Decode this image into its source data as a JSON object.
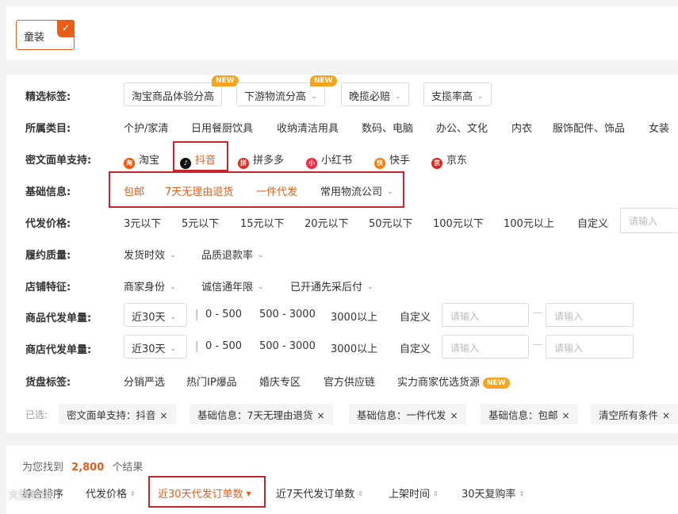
{
  "top": {
    "category_chip": "童装",
    "check": "✓"
  },
  "filters": {
    "featured_label": "精选标签:",
    "featured_items": [
      {
        "label": "淘宝商品体验分高",
        "new": true,
        "dropdown": false
      },
      {
        "label": "下游物流分高",
        "new": true,
        "dropdown": true
      },
      {
        "label": "晚揽必赔",
        "new": false,
        "dropdown": true
      },
      {
        "label": "支揽率高",
        "new": false,
        "dropdown": true
      }
    ],
    "new_badge": "NEW",
    "category_label": "所属类目:",
    "category_items": [
      "个护/家清",
      "日用餐厨饮具",
      "收纳清洁用具",
      "数码、电脑",
      "办公、文化",
      "内衣",
      "服饰配件、饰品",
      "女装"
    ],
    "waybill_label": "密文面单支持:",
    "waybill_items": [
      "淘宝",
      "抖音",
      "拼多多",
      "小红书",
      "快手",
      "京东"
    ],
    "basic_label": "基础信息:",
    "basic_items": [
      "包邮",
      "7天无理由退货",
      "一件代发",
      "常用物流公司"
    ],
    "price_label": "代发价格:",
    "price_items": [
      "3元以下",
      "5元以下",
      "15元以下",
      "20元以下",
      "50元以下",
      "100元以下",
      "100元以上",
      "自定义"
    ],
    "price_placeholder": "请输入",
    "fulfill_label": "履约质量:",
    "fulfill_items": [
      "发货时效",
      "品质退款率"
    ],
    "shop_label": "店铺特征:",
    "shop_items": [
      "商家身份",
      "诚信通年限",
      "已开通先采后付"
    ],
    "product_volume_label": "商品代发单量:",
    "shop_volume_label": "商店代发单量:",
    "period": "近30天",
    "volume_items": [
      "0 - 500",
      "500 - 3000",
      "3000以上",
      "自定义"
    ],
    "volume_placeholder": "请输入",
    "sep": "|",
    "dash": "—",
    "goods_label": "货盘标签:",
    "goods_items": [
      "分销严选",
      "热门IP爆品",
      "婚庆专区",
      "官方供应链",
      "实力商家优选货源"
    ],
    "selected_label": "已选:",
    "selected_items": [
      "密文面单支持：抖音",
      "基础信息：7天无理由退货",
      "基础信息：一件代发",
      "基础信息：包邮"
    ],
    "close_x": "×",
    "clear_all": "清空所有条件"
  },
  "results": {
    "prefix": "为您找到",
    "count": "2,800",
    "suffix": "个结果",
    "sort_items": [
      "综合排序",
      "代发价格",
      "近30天代发订单数",
      "近7天代发订单数",
      "上架时间",
      "30天复购率"
    ],
    "watermark": "大数跨境"
  },
  "colors": {
    "accent": "#e85d1a",
    "highlight_box": "#c9232c",
    "new_badge": "#f6a31d"
  },
  "icons": [
    "check-icon",
    "chevron-down-icon",
    "taobao-icon",
    "douyin-icon",
    "pinduoduo-icon",
    "xiaohongshu-icon",
    "kuaishou-icon",
    "jingdong-icon",
    "sort-arrows-icon"
  ]
}
